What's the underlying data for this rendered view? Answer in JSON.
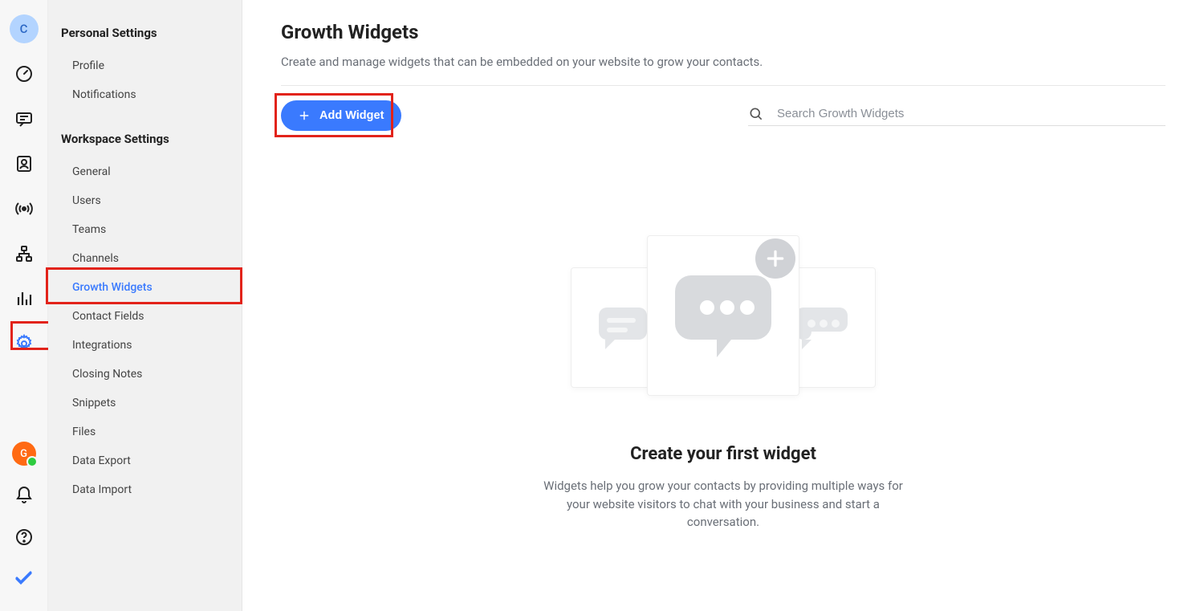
{
  "rail": {
    "avatar_top": "C",
    "avatar_bottom": "G"
  },
  "sidebar": {
    "personal_header": "Personal Settings",
    "personal_items": [
      {
        "label": "Profile"
      },
      {
        "label": "Notifications"
      }
    ],
    "workspace_header": "Workspace Settings",
    "workspace_items": [
      {
        "label": "General"
      },
      {
        "label": "Users"
      },
      {
        "label": "Teams"
      },
      {
        "label": "Channels"
      },
      {
        "label": "Growth Widgets",
        "active": true,
        "highlight": true
      },
      {
        "label": "Contact Fields"
      },
      {
        "label": "Integrations"
      },
      {
        "label": "Closing Notes"
      },
      {
        "label": "Snippets"
      },
      {
        "label": "Files"
      },
      {
        "label": "Data Export"
      },
      {
        "label": "Data Import"
      }
    ]
  },
  "main": {
    "title": "Growth Widgets",
    "subtitle": "Create and manage widgets that can be embedded on your website to grow your contacts.",
    "add_button": "Add Widget",
    "search_placeholder": "Search Growth Widgets",
    "empty_title": "Create your first widget",
    "empty_sub": "Widgets help you grow your contacts by providing multiple ways for your website visitors to chat with your business and start a conversation."
  }
}
